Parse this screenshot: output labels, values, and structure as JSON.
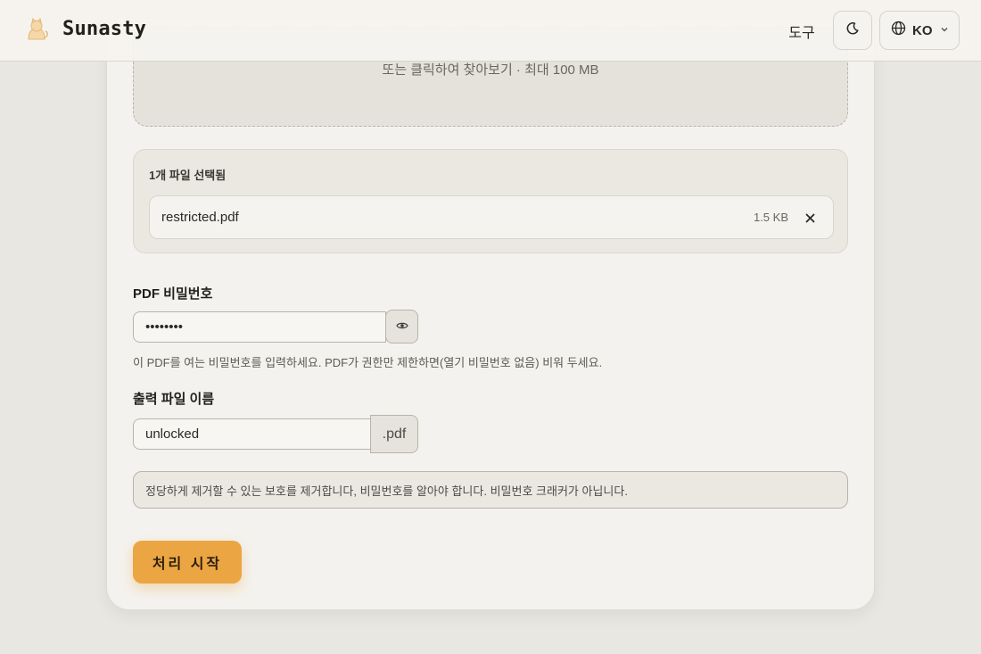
{
  "header": {
    "brand": "Sunasty",
    "nav_tools": "도구",
    "language_code": "KO"
  },
  "dropzone": {
    "hint": "또는 클릭하여 찾아보기 · 최대 100 MB"
  },
  "selected_files": {
    "title": "1개 파일 선택됨",
    "files": [
      {
        "name": "restricted.pdf",
        "size": "1.5 KB"
      }
    ]
  },
  "password": {
    "label": "PDF 비밀번호",
    "value": "••••••••",
    "help": "이 PDF를 여는 비밀번호를 입력하세요. PDF가 권한만 제한하면(열기 비밀번호 없음) 비워 두세요."
  },
  "output": {
    "label": "출력 파일 이름",
    "value": "unlocked",
    "suffix": ".pdf"
  },
  "notice": "정당하게 제거할 수 있는 보호를 제거합니다, 비밀번호를 알아야 합니다. 비밀번호 크래커가 아닙니다.",
  "actions": {
    "start_label": "처리 시작"
  },
  "colors": {
    "accent": "#eba543",
    "background": "#e9e7e2",
    "card": "#f4f2ee"
  },
  "icons": {
    "logo": "cat-logo-icon",
    "theme": "moon-icon",
    "language": "globe-icon",
    "dropdown": "chevron-down-icon",
    "remove": "close-icon",
    "visibility": "eye-icon"
  }
}
